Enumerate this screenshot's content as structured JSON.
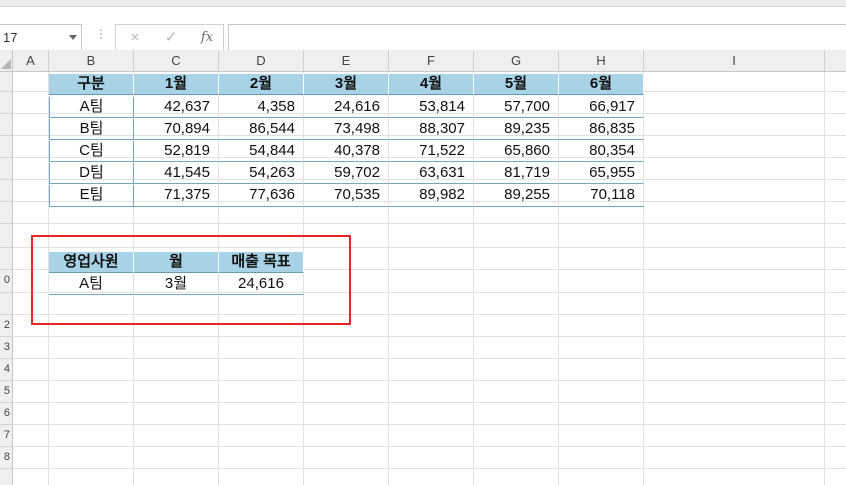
{
  "formula_bar": {
    "name_box": "17",
    "cancel_icon": "×",
    "enter_icon": "✓",
    "function_icon": "fx",
    "formula": ""
  },
  "columns": [
    "A",
    "B",
    "C",
    "D",
    "E",
    "F",
    "G",
    "H",
    "I"
  ],
  "rows": [
    "",
    "",
    "",
    "",
    "",
    "",
    "",
    "",
    "",
    "0",
    "",
    "2",
    "3",
    "4",
    "5",
    "6",
    "7",
    "8",
    ""
  ],
  "sales_table": {
    "headers": [
      "구분",
      "1월",
      "2월",
      "3월",
      "4월",
      "5월",
      "6월"
    ],
    "rows": [
      {
        "team": "A팀",
        "values": [
          "42,637",
          "4,358",
          "24,616",
          "53,814",
          "57,700",
          "66,917"
        ]
      },
      {
        "team": "B팀",
        "values": [
          "70,894",
          "86,544",
          "73,498",
          "88,307",
          "89,235",
          "86,835"
        ]
      },
      {
        "team": "C팀",
        "values": [
          "52,819",
          "54,844",
          "40,378",
          "71,522",
          "65,860",
          "80,354"
        ]
      },
      {
        "team": "D팀",
        "values": [
          "41,545",
          "54,263",
          "59,702",
          "63,631",
          "81,719",
          "65,955"
        ]
      },
      {
        "team": "E팀",
        "values": [
          "71,375",
          "77,636",
          "70,535",
          "89,982",
          "89,255",
          "70,118"
        ]
      }
    ]
  },
  "lookup_table": {
    "headers": [
      "영업사원",
      "월",
      "매출 목표"
    ],
    "row": [
      "A팀",
      "3월",
      "24,616"
    ]
  },
  "colors": {
    "header_fill": "#a8d3e6",
    "highlight_box": "#e8232a"
  }
}
